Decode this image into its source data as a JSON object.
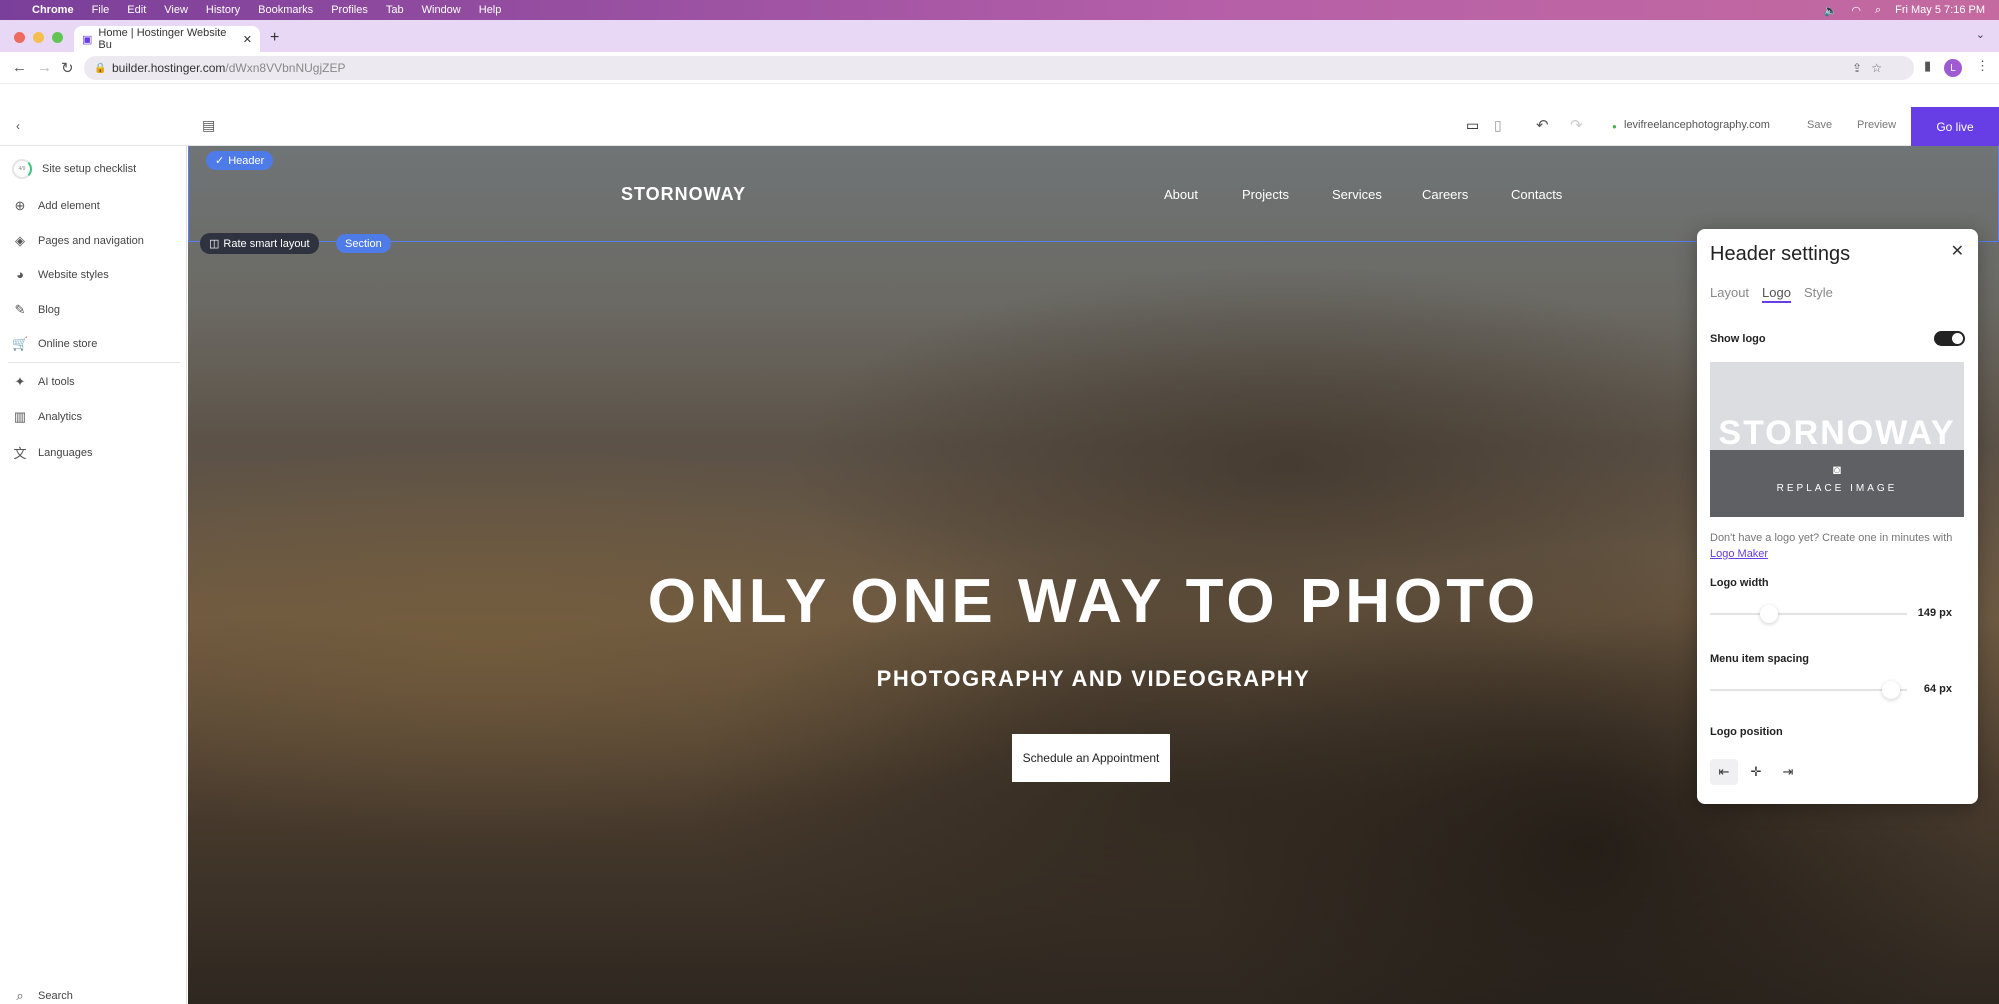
{
  "macmenu": {
    "items": [
      "Chrome",
      "File",
      "Edit",
      "View",
      "History",
      "Bookmarks",
      "Profiles",
      "Tab",
      "Window",
      "Help"
    ],
    "clock": "Fri May 5  7:16 PM"
  },
  "browser": {
    "tab_title": "Home | Hostinger Website Bu",
    "url_host": "builder.hostinger.com",
    "url_path": "/dWxn8VVbnNUgjZEP",
    "profile_initial": "L"
  },
  "toolbar": {
    "domain": "levifreelancephotography.com",
    "save": "Save",
    "preview": "Preview",
    "go_live": "Go live",
    "accent": "#673de6"
  },
  "sidebar": {
    "checklist": {
      "label": "Site setup checklist",
      "progress": "4/9"
    },
    "items": [
      {
        "label": "Add element",
        "icon": "plus-circle-icon"
      },
      {
        "label": "Pages and navigation",
        "icon": "layers-icon"
      },
      {
        "label": "Website styles",
        "icon": "palette-icon"
      },
      {
        "label": "Blog",
        "icon": "pen-icon"
      },
      {
        "label": "Online store",
        "icon": "cart-icon"
      },
      {
        "label": "AI tools",
        "icon": "sparkle-icon"
      },
      {
        "label": "Analytics",
        "icon": "chart-icon"
      },
      {
        "label": "Languages",
        "icon": "translate-icon"
      }
    ],
    "search": "Search"
  },
  "canvas": {
    "header_badge": "Header",
    "rate_layout": "Rate smart layout",
    "section_badge": "Section",
    "site_logo": "STORNOWAY",
    "menu": [
      "About",
      "Projects",
      "Services",
      "Careers",
      "Contacts"
    ],
    "headline": "ONLY ONE WAY TO PHOTO",
    "subheadline": "PHOTOGRAPHY AND VIDEOGRAPHY",
    "cta": "Schedule an Appointment"
  },
  "panel": {
    "title": "Header settings",
    "tabs": [
      "Layout",
      "Logo",
      "Style"
    ],
    "active_tab": "Logo",
    "show_logo": "Show logo",
    "show_logo_on": true,
    "logo_preview": "STORNOWAY",
    "replace_image": "REPLACE IMAGE",
    "hint": "Don't have a logo yet? Create one in minutes with",
    "hint_link": "Logo Maker",
    "logo_width_label": "Logo width",
    "logo_width": "149 px",
    "logo_width_fraction": 0.3,
    "spacing_label": "Menu item spacing",
    "spacing": "64 px",
    "spacing_fraction": 0.92,
    "position_label": "Logo position"
  }
}
